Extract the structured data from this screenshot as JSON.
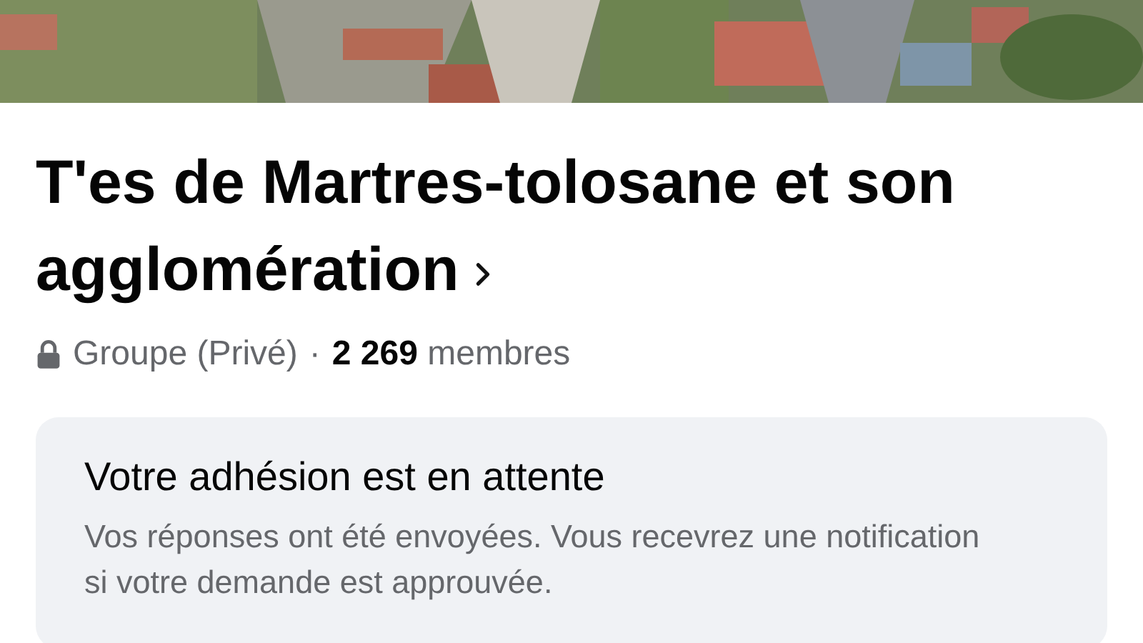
{
  "group": {
    "name": "T'es de Martres-tolosane et son agglomération",
    "privacy": "Groupe (Privé)",
    "separator": "·",
    "member_count": "2 269",
    "member_label": "membres"
  },
  "notice": {
    "title": "Votre adhésion est en attente",
    "message": "Vos réponses ont été envoyées. Vous recevrez une notification si votre demande est approuvée."
  }
}
